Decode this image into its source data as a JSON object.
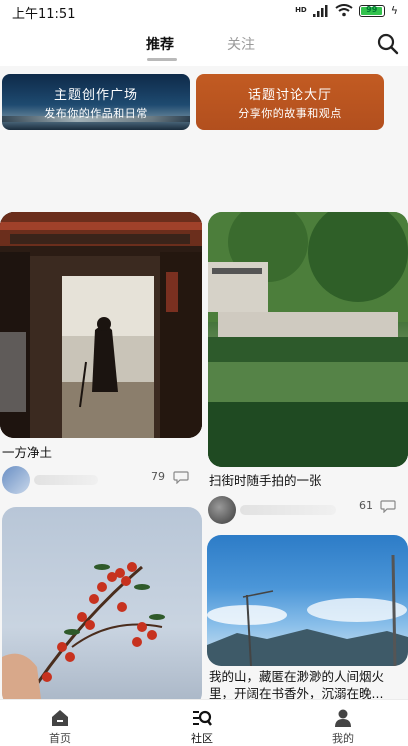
{
  "status_bar": {
    "time": "上午11:51",
    "network_badge": "HD",
    "battery_percent": "99",
    "battery_level": 0.99
  },
  "top_tabs": {
    "items": [
      {
        "label": "推荐",
        "active": true
      },
      {
        "label": "关注",
        "active": false
      }
    ],
    "search_icon": "search-icon"
  },
  "banners": [
    {
      "title": "主题创作广场",
      "subtitle": "发布你的作品和日常"
    },
    {
      "title": "话题讨论大厅",
      "subtitle": "分享你的故事和观点"
    }
  ],
  "feed": {
    "posts": [
      {
        "title": "一方净土",
        "likes": "79",
        "image": "temple-doorway-photo"
      },
      {
        "title": "扫街时随手拍的一张",
        "likes": "61",
        "image": "canal-town-photo"
      },
      {
        "title": "",
        "likes": "",
        "image": "red-berries-photo"
      },
      {
        "title": "我的山，藏匿在渺渺的人间烟火里，开阔在书香外，沉溺在晚...",
        "likes": "",
        "image": "mountain-sky-photo"
      }
    ]
  },
  "bottom_nav": {
    "items": [
      {
        "label": "首页",
        "icon": "home-icon"
      },
      {
        "label": "社区",
        "icon": "community-icon",
        "active": true
      },
      {
        "label": "我的",
        "icon": "user-icon"
      }
    ]
  },
  "colors": {
    "topic_banner": "#c25b22",
    "creation_banner": "#0e2a49",
    "battery_green": "#33c24d"
  }
}
